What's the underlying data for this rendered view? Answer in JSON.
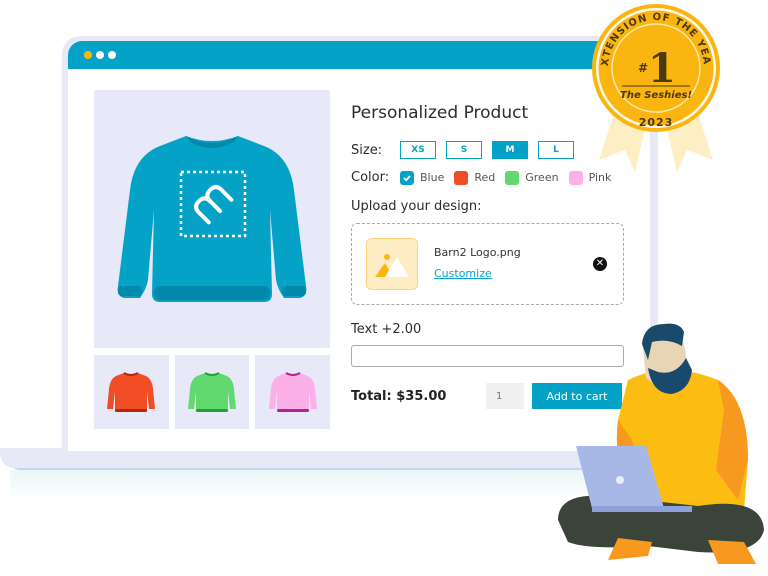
{
  "window": {
    "titlebar_dots": [
      "yellow",
      "white",
      "white"
    ],
    "accent": "#05a2c7"
  },
  "product": {
    "title": "Personalized Product",
    "main_image": {
      "icon": "sweater-icon",
      "color": "#05a2c7",
      "design": "barn2-logo"
    },
    "thumbnails": [
      {
        "color_name": "Red",
        "color": "#f04d25"
      },
      {
        "color_name": "Green",
        "color": "#62d96e"
      },
      {
        "color_name": "Pink",
        "color": "#fdb0e8"
      }
    ]
  },
  "size": {
    "label": "Size:",
    "options": [
      "XS",
      "S",
      "M",
      "L"
    ],
    "selected": "M"
  },
  "color": {
    "label": "Color:",
    "options": [
      {
        "label": "Blue",
        "hex": "#05a2c7",
        "checked": true
      },
      {
        "label": "Red",
        "hex": "#f04d25",
        "checked": false
      },
      {
        "label": "Green",
        "hex": "#62d96e",
        "checked": false
      },
      {
        "label": "Pink",
        "hex": "#fdb0e8",
        "checked": false
      }
    ]
  },
  "upload": {
    "label": "Upload your design:",
    "file_name": "Barn2 Logo.png",
    "customize_link": "Customize",
    "remove_icon": "✕"
  },
  "text_field": {
    "label": "Text +2.00",
    "value": ""
  },
  "purchase": {
    "total": "Total: $35.00",
    "quantity": "1",
    "add_to_cart": "Add to cart"
  },
  "badge": {
    "arc_text": "EXTENSION OF THE YEAR",
    "hash": "#",
    "rank": "1",
    "award": "The Seshies!",
    "year": "2023"
  }
}
